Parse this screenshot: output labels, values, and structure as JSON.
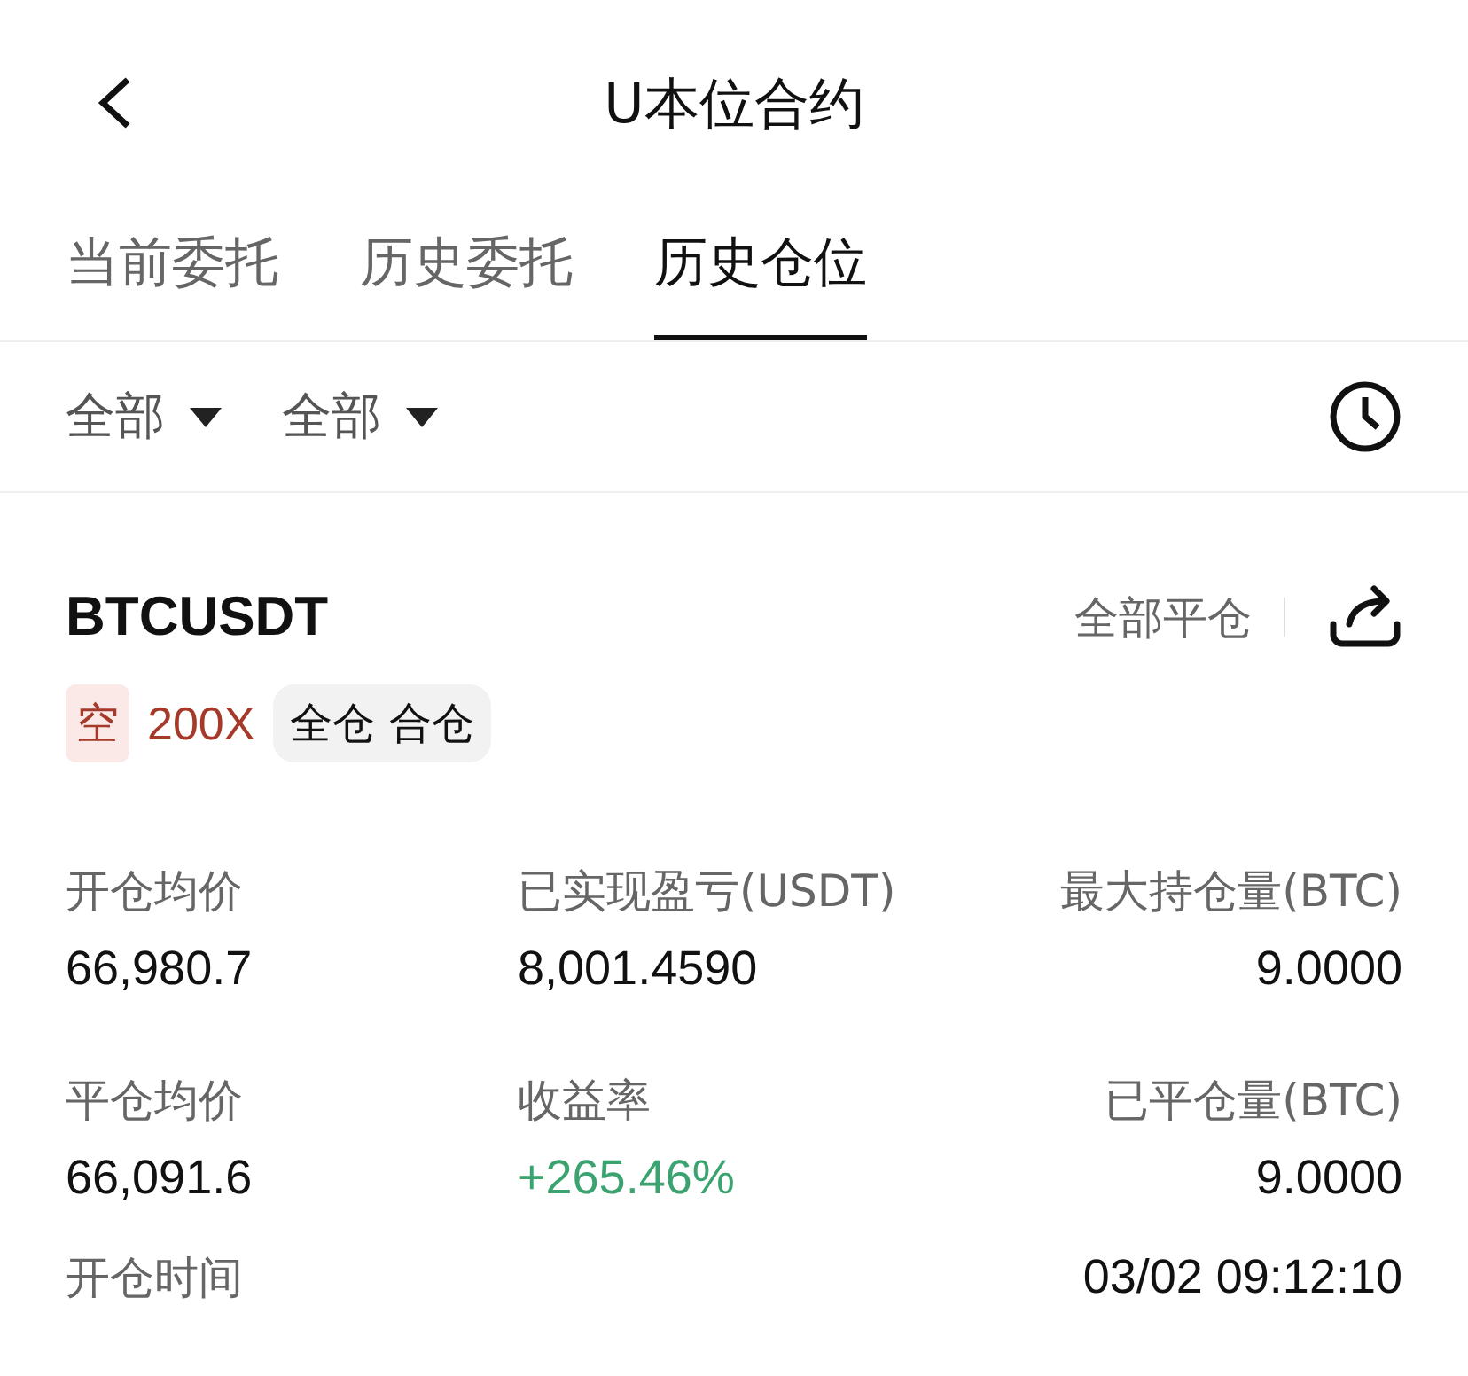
{
  "header": {
    "title": "U本位合约"
  },
  "tabs": [
    {
      "label": "当前委托",
      "selected": false
    },
    {
      "label": "历史委托",
      "selected": false
    },
    {
      "label": "历史仓位",
      "selected": true
    }
  ],
  "filters": [
    {
      "label": "全部"
    },
    {
      "label": "全部"
    }
  ],
  "position": {
    "symbol": "BTCUSDT",
    "close_all": "全部平仓",
    "side": "空",
    "leverage": "200X",
    "margin_mode": "全仓 合仓",
    "stats": [
      {
        "label": "开仓均价",
        "value": "66,980.7",
        "color": "#111111"
      },
      {
        "label": "已实现盈亏(USDT)",
        "value": "8,001.4590",
        "color": "#111111"
      },
      {
        "label": "最大持仓量(BTC)",
        "value": "9.0000",
        "color": "#111111"
      },
      {
        "label": "平仓均价",
        "value": "66,091.6",
        "color": "#111111"
      },
      {
        "label": "收益率",
        "value": "+265.46%",
        "color": "#3aa36f"
      },
      {
        "label": "已平仓量(BTC)",
        "value": "9.0000",
        "color": "#111111"
      }
    ],
    "times": [
      {
        "label": "开仓时间",
        "value": "03/02 09:12:10"
      }
    ]
  }
}
